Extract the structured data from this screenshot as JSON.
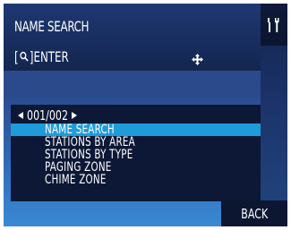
{
  "header": {
    "title": "NAME SEARCH",
    "enter_open": "[",
    "enter_close": "]ENTER"
  },
  "list": {
    "page_indicator": "001/002",
    "items": [
      {
        "label": "NAME SEARCH",
        "selected": true
      },
      {
        "label": "STATIONS BY AREA",
        "selected": false
      },
      {
        "label": "STATIONS BY TYPE",
        "selected": false
      },
      {
        "label": "PAGING ZONE",
        "selected": false
      },
      {
        "label": "CHIME ZONE",
        "selected": false
      }
    ]
  },
  "footer": {
    "back_label": "BACK"
  },
  "icons": {
    "search": "search-icon",
    "cursor": "move-cursor-icon",
    "tools": "tools-icon",
    "prev": "triangle-left-icon",
    "next": "triangle-right-icon"
  },
  "colors": {
    "selection": "#1e9bd9",
    "header_bg": "#13264f",
    "screen_bg": "#2a4a8c"
  }
}
